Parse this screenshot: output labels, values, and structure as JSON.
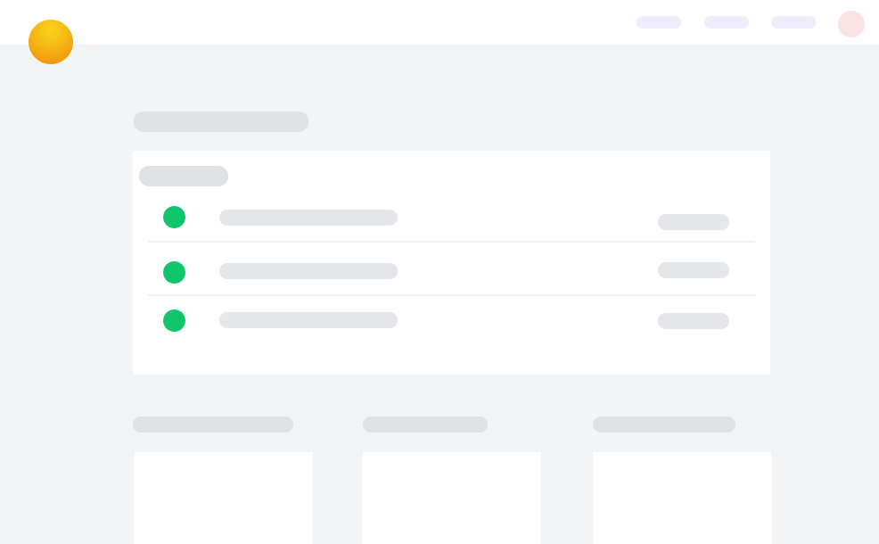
{
  "header": {
    "logo": "logo-gradient-circle",
    "nav_items": [
      "",
      "",
      ""
    ],
    "avatar": "user-avatar"
  },
  "colors": {
    "header_bg": "#ffffff",
    "page_bg": "#f3f4f6",
    "skeleton": "#dfe1e4",
    "nav_pill": "#eeecfd",
    "avatar": "#fbe3e3",
    "status_dot": "#11c56a",
    "logo_start": "#f7d51d",
    "logo_end": "#f08a0b"
  },
  "main": {
    "page_title": "",
    "list_card": {
      "heading": "",
      "rows": [
        {
          "status": "green",
          "title": "",
          "meta": ""
        },
        {
          "status": "green",
          "title": "",
          "meta": ""
        },
        {
          "status": "green",
          "title": "",
          "meta": ""
        }
      ]
    },
    "sections": [
      {
        "heading": ""
      },
      {
        "heading": ""
      },
      {
        "heading": ""
      }
    ]
  }
}
